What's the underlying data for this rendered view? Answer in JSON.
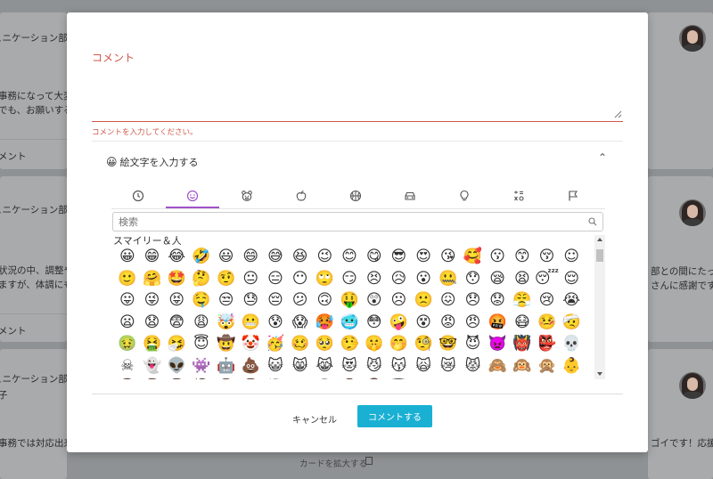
{
  "background": {
    "cards": [
      {
        "dept": "ュニケーション部",
        "line1": "事務になって大変",
        "line2": "でも、お願いすること"
      },
      {
        "dept": "ュニケーション部",
        "line1": "状況の中、調整や対",
        "line2": "ますが、体調にも"
      },
      {
        "dept": "ュニケーション部",
        "line1": "子",
        "line2": "事務では対応出来ない"
      }
    ],
    "comment_label": "メント",
    "right_snippets": [
      "部との間にたっ",
      "さんに感謝です！",
      "ゴイです！応援し"
    ],
    "expand_card_label": "カードを拡大する"
  },
  "modal": {
    "comment_label": "コメント",
    "comment_value": "",
    "error_text": "コメントを入力してください。",
    "emoji_toggle_label": "絵文字を入力する",
    "emoji_toggle_icon": "😀",
    "tabs": [
      {
        "name": "recent",
        "icon": "clock-icon"
      },
      {
        "name": "smileys",
        "icon": "smiley-icon",
        "active": true
      },
      {
        "name": "animals",
        "icon": "bear-icon"
      },
      {
        "name": "food",
        "icon": "apple-icon"
      },
      {
        "name": "activity",
        "icon": "basketball-icon"
      },
      {
        "name": "travel",
        "icon": "car-icon"
      },
      {
        "name": "objects",
        "icon": "lightbulb-icon"
      },
      {
        "name": "symbols",
        "icon": "symbols-icon"
      },
      {
        "name": "flags",
        "icon": "flag-icon"
      }
    ],
    "search_placeholder": "検索",
    "category_label": "スマイリー＆人",
    "emojis": "😀😁😂🤣😃😄😅😆😉😊😋😎😍😘🥰😗😙😚☺🙂🤗🤩🤔🤨😐😑😶🙄😏😣😥😮🤐😯😪😫😴😌😛😜😝🤤😒😓😔😕🙃🤑😲☹🙁😖😞😟😤😢😭😦😧😨😩🤯😬😰😱🥵🥶😳🤪😵😡😠🤬😷🤒🤕🤢🤮🤧😇🤠🤡🥳🥴🥺🤥🤫🤭🧐🤓😈👿👹👺💀☠👻👽👾🤖💩😺😸😹😻😼😽🙀😿😾🙈🙉🙊👶🧒👦👧🧑👨👩🧓👴👵👨‍⚕️👩‍⚕️👨‍🎓",
    "cancel_label": "キャンセル",
    "submit_label": "コメントする",
    "colors": {
      "accent_error": "#d0574a",
      "primary_button": "#1ab0d3",
      "tab_active": "#a052c8"
    }
  }
}
